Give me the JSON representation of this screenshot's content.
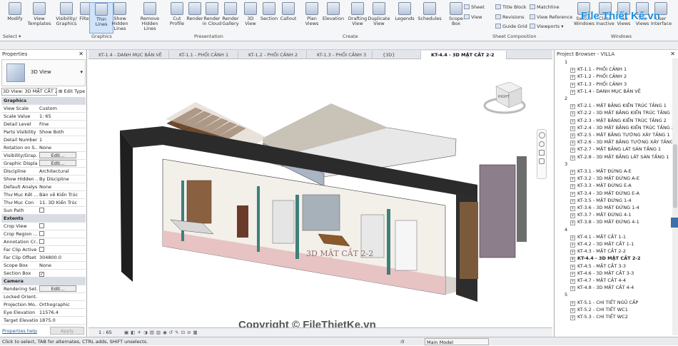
{
  "ribbon": {
    "buttons": [
      "Modify",
      "View\nTemplates",
      "Visibility/\nGraphics",
      "Filters",
      "Thin\nLines",
      "Show\nHidden Lines",
      "Remove\nHidden Lines",
      "Cut\nProfile",
      "Render",
      "Render\nin Cloud",
      "Render\nGallery",
      "3D\nView",
      "Section",
      "Callout",
      "Plan\nViews",
      "Elevation",
      "Drafting\nView",
      "Duplicate\nView",
      "Legends",
      "Schedules",
      "Scope\nBox"
    ],
    "groups": [
      "Select ▾",
      "Graphics",
      "Presentation",
      "Create",
      "Sheet Composition",
      "Windows"
    ],
    "sheet_items": [
      "Sheet",
      "Title Block",
      "Matchline",
      "View",
      "Revisions",
      "View Reference",
      "Guide Grid",
      "Viewports ▾"
    ],
    "window_items": [
      "Switch\nWindows",
      "Close\nInactive",
      "Tab\nViews",
      "Tile\nViews",
      "User\nInterface"
    ],
    "watermark_top": "File Thiết Kế.vn"
  },
  "tabs": [
    "KT-1.4 - DANH MỤC BẢN VẼ",
    "KT-1.1 - PHỐI CẢNH 1",
    "KT-1.2 - PHỐI CẢNH 2",
    "KT-1.3 - PHỐI CẢNH 3",
    "{3D}",
    "KT-4.4 - 3D MẶT CẮT 2-2"
  ],
  "properties": {
    "title": "Properties",
    "type_name": "3D View",
    "selector": "3D View: 3D MẶT CẮT 2",
    "edit_type": "Edit Type",
    "rows": [
      {
        "k": "Graphics",
        "sec": true
      },
      {
        "k": "View Scale",
        "v": "Custom"
      },
      {
        "k": "Scale Value",
        "v": "1:  65"
      },
      {
        "k": "Detail Level",
        "v": "Fine"
      },
      {
        "k": "Parts Visibility",
        "v": "Show Both"
      },
      {
        "k": "Detail Number",
        "v": "1"
      },
      {
        "k": "Rotation on S...",
        "v": "None"
      },
      {
        "k": "Visibility/Grap...",
        "v": "Edit...",
        "btn": true
      },
      {
        "k": "Graphic Displa...",
        "v": "Edit...",
        "btn": true
      },
      {
        "k": "Discipline",
        "v": "Architectural"
      },
      {
        "k": "Show Hidden ...",
        "v": "By Discipline"
      },
      {
        "k": "Default Analys...",
        "v": "None"
      },
      {
        "k": "Thư Mục Kết ...",
        "v": "Bản vẽ Kiến Trúc"
      },
      {
        "k": "Thư Mục Con",
        "v": "11. 3D Kiến Trúc"
      },
      {
        "k": "Sun Path",
        "cb": true
      },
      {
        "k": "Extents",
        "sec": true
      },
      {
        "k": "Crop View",
        "cb": true
      },
      {
        "k": "Crop Region ...",
        "cb": true
      },
      {
        "k": "Annotation Cr...",
        "cb": true
      },
      {
        "k": "Far Clip Active",
        "cb": true
      },
      {
        "k": "Far Clip Offset",
        "v": "304800.0"
      },
      {
        "k": "Scope Box",
        "v": "None"
      },
      {
        "k": "Section Box",
        "cb": true,
        "checked": true
      },
      {
        "k": "Camera",
        "sec": true
      },
      {
        "k": "Rendering Set...",
        "v": "Edit...",
        "btn": true
      },
      {
        "k": "Locked Orient..."
      },
      {
        "k": "Projection Mo...",
        "v": "Orthographic"
      },
      {
        "k": "Eye Elevation",
        "v": "11576.4"
      },
      {
        "k": "Target Elevation",
        "v": "1875.0"
      }
    ],
    "help": "Properties help",
    "apply": "Apply"
  },
  "browser": {
    "title": "Project Browser - VILLA",
    "items": [
      {
        "t": "1",
        "lvl": 0
      },
      {
        "t": "KT-1.1 - PHỐI CẢNH 1",
        "lvl": 1
      },
      {
        "t": "KT-1.2 - PHỐI CẢNH 2",
        "lvl": 1
      },
      {
        "t": "KT-1.3 - PHỐI CẢNH 3",
        "lvl": 1
      },
      {
        "t": "KT-1.4 - DANH MỤC BẢN VẼ",
        "lvl": 1
      },
      {
        "t": "2",
        "lvl": 0
      },
      {
        "t": "KT-2.1 - MẶT BẰNG KIẾN TRÚC TẦNG 1",
        "lvl": 1
      },
      {
        "t": "KT-2.2 - 3D MẶT BẰNG KIẾN TRÚC TẦNG 1",
        "lvl": 1
      },
      {
        "t": "KT-2.3 - MẶT BẰNG KIẾN TRÚC TẦNG 2",
        "lvl": 1
      },
      {
        "t": "KT-2.4 - 3D MẶT BẰNG KIẾN TRÚC TẦNG 2",
        "lvl": 1
      },
      {
        "t": "KT-2.5 - MẶT BẰNG TƯỜNG XÂY TẦNG 1",
        "lvl": 1
      },
      {
        "t": "KT-2.6 - 3D MẶT BẰNG TƯỜNG XÂY TẦNG",
        "lvl": 1
      },
      {
        "t": "KT-2.7 - MẶT BẰNG LÁT SÀN TẦNG 1",
        "lvl": 1
      },
      {
        "t": "KT-2.8 - 3D MẶT BẰNG LÁT SÀN TẦNG 1",
        "lvl": 1
      },
      {
        "t": "3",
        "lvl": 0
      },
      {
        "t": "KT-3.1 - MẶT ĐỨNG A-E",
        "lvl": 1
      },
      {
        "t": "KT-3.2 - 3D MẶT ĐỨNG A-E",
        "lvl": 1
      },
      {
        "t": "KT-3.3 - MẶT ĐỨNG E-A",
        "lvl": 1
      },
      {
        "t": "KT-3.4 - 3D MẶT ĐỨNG E-A",
        "lvl": 1
      },
      {
        "t": "KT-3.5 - MẶT ĐỨNG 1-4",
        "lvl": 1
      },
      {
        "t": "KT-3.6 - 3D MẶT ĐỨNG 1-4",
        "lvl": 1
      },
      {
        "t": "KT-3.7 - MẶT ĐỨNG 4-1",
        "lvl": 1
      },
      {
        "t": "KT-3.8 - 3D MẶT ĐỨNG 4-1",
        "lvl": 1
      },
      {
        "t": "4",
        "lvl": 0
      },
      {
        "t": "KT-4.1 - MẶT CẮT 1-1",
        "lvl": 1
      },
      {
        "t": "KT-4.2 - 3D MẶT CẮT 1-1",
        "lvl": 1
      },
      {
        "t": "KT-4.3 - MẶT CẮT 2-2",
        "lvl": 1
      },
      {
        "t": "KT-4.4 - 3D MẶT CẮT 2-2",
        "lvl": 1,
        "sel": true
      },
      {
        "t": "KT-4.5 - MẶT CẮT 3-3",
        "lvl": 1
      },
      {
        "t": "KT-4.6 - 3D MẶT CẮT 3-3",
        "lvl": 1
      },
      {
        "t": "KT-4.7 - MẶT CẮT 4-4",
        "lvl": 1
      },
      {
        "t": "KT-4.8 - 3D MẶT CẮT 4-4",
        "lvl": 1
      },
      {
        "t": "5",
        "lvl": 0
      },
      {
        "t": "KT-5.1 - CHI TIẾT NGŨ CẤP",
        "lvl": 1
      },
      {
        "t": "KT-5.2 - CHI TIẾT WC1",
        "lvl": 1
      },
      {
        "t": "KT-5.3 - CHI TIẾT WC2",
        "lvl": 1
      }
    ]
  },
  "view": {
    "scale": "1 : 65",
    "viewcube_label": "RIGHT",
    "section_label": "3D MẶT CẮT 2-2",
    "watermark": "Copyright © FileThietKe.vn"
  },
  "status": {
    "message": "Click to select, TAB for alternates, CTRL adds, SHIFT unselects.",
    "model": "Main Model",
    "filter_count": ":0"
  }
}
